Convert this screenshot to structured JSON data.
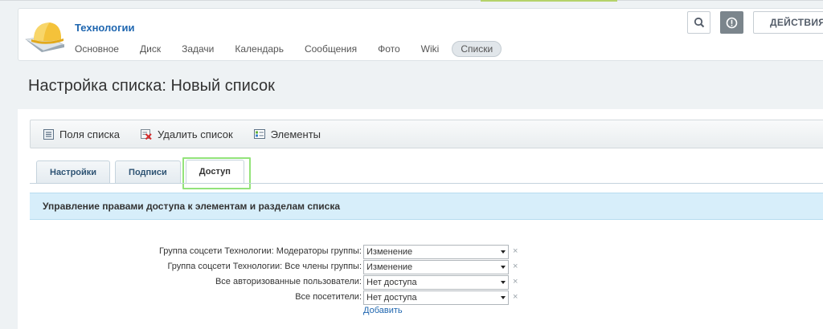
{
  "header": {
    "group_title": "Технологии",
    "nav": [
      {
        "label": "Основное",
        "active": false
      },
      {
        "label": "Диск",
        "active": false
      },
      {
        "label": "Задачи",
        "active": false
      },
      {
        "label": "Календарь",
        "active": false
      },
      {
        "label": "Сообщения",
        "active": false
      },
      {
        "label": "Фото",
        "active": false
      },
      {
        "label": "Wiki",
        "active": false
      },
      {
        "label": "Списки",
        "active": true
      }
    ],
    "actions_label": "ДЕЙСТВИЯ"
  },
  "page": {
    "title": "Настройка списка: Новый список"
  },
  "toolbar": {
    "fields_label": "Поля списка",
    "delete_label": "Удалить список",
    "elements_label": "Элементы"
  },
  "tabs": [
    {
      "label": "Настройки",
      "active": false
    },
    {
      "label": "Подписи",
      "active": false
    },
    {
      "label": "Доступ",
      "active": true
    }
  ],
  "section": {
    "title": "Управление правами доступа к элементам и разделам списка"
  },
  "permissions": [
    {
      "label": "Группа соцсети Технологии: Модераторы группы:",
      "value": "Изменение"
    },
    {
      "label": "Группа соцсети Технологии: Все члены группы:",
      "value": "Изменение"
    },
    {
      "label": "Все авторизованные пользователи:",
      "value": "Нет доступа"
    },
    {
      "label": "Все посетители:",
      "value": "Нет доступа"
    }
  ],
  "add_label": "Добавить",
  "remove_symbol": "×",
  "colors": {
    "link": "#2067b0",
    "section_bg": "#d7eefa",
    "highlight": "#93e37a"
  }
}
